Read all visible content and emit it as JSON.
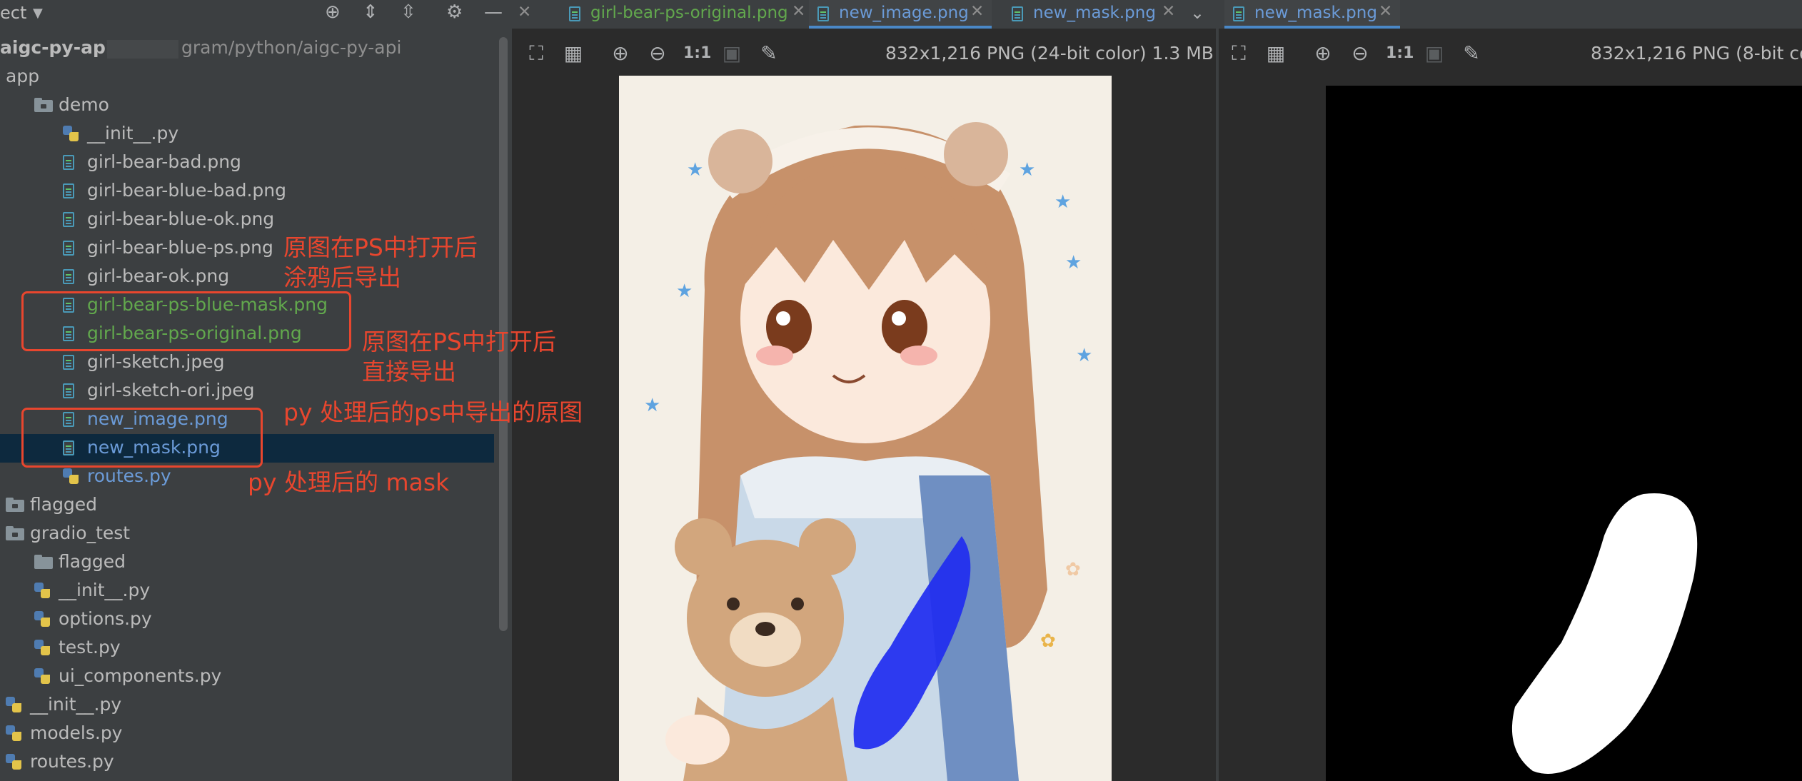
{
  "project_panel": {
    "header_label": "ect",
    "root_name": "aigc-py-api",
    "root_path": "gram/python/aigc-py-api",
    "items": [
      {
        "label": "app",
        "kind": "folder-open",
        "color": "white"
      },
      {
        "label": "demo",
        "kind": "folder",
        "color": "white"
      },
      {
        "label": "__init__.py",
        "kind": "py",
        "color": "white"
      },
      {
        "label": "girl-bear-bad.png",
        "kind": "img",
        "color": "white"
      },
      {
        "label": "girl-bear-blue-bad.png",
        "kind": "img",
        "color": "white"
      },
      {
        "label": "girl-bear-blue-ok.png",
        "kind": "img",
        "color": "white"
      },
      {
        "label": "girl-bear-blue-ps.png",
        "kind": "img",
        "color": "white"
      },
      {
        "label": "girl-bear-ok.png",
        "kind": "img",
        "color": "white"
      },
      {
        "label": "girl-bear-ps-blue-mask.png",
        "kind": "img",
        "color": "green"
      },
      {
        "label": "girl-bear-ps-original.png",
        "kind": "img",
        "color": "green"
      },
      {
        "label": "girl-sketch.jpeg",
        "kind": "img",
        "color": "white"
      },
      {
        "label": "girl-sketch-ori.jpeg",
        "kind": "img",
        "color": "white"
      },
      {
        "label": "new_image.png",
        "kind": "img",
        "color": "blue"
      },
      {
        "label": "new_mask.png",
        "kind": "img",
        "color": "blue",
        "selected": true
      },
      {
        "label": "routes.py",
        "kind": "py",
        "color": "blue"
      },
      {
        "label": "flagged",
        "kind": "folder",
        "color": "white"
      },
      {
        "label": "gradio_test",
        "kind": "folder",
        "color": "white"
      },
      {
        "label": "flagged",
        "kind": "folder-plain",
        "color": "white"
      },
      {
        "label": "__init__.py",
        "kind": "py",
        "color": "white"
      },
      {
        "label": "options.py",
        "kind": "py",
        "color": "white"
      },
      {
        "label": "test.py",
        "kind": "py",
        "color": "white"
      },
      {
        "label": "ui_components.py",
        "kind": "py",
        "color": "white"
      },
      {
        "label": "__init__.py",
        "kind": "py",
        "color": "white"
      },
      {
        "label": "models.py",
        "kind": "py",
        "color": "white"
      },
      {
        "label": "routes.py",
        "kind": "py",
        "color": "white"
      }
    ]
  },
  "annotations": {
    "note1_line1": "原图在PS中打开后",
    "note1_line2": "涂鸦后导出",
    "note2_line1": "原图在PS中打开后",
    "note2_line2": "直接导出",
    "note3": "py 处理后的ps中导出的原图",
    "note4": "py 处理后的 mask"
  },
  "tabs": [
    {
      "label": "girl-bear-ps-original.png",
      "active": false,
      "color": "green"
    },
    {
      "label": "new_image.png",
      "active": true,
      "color": "blue"
    },
    {
      "label": "new_mask.png",
      "active": false,
      "color": "blue"
    },
    {
      "label": "new_mask.png",
      "active": true,
      "color": "blue"
    }
  ],
  "viewer_left": {
    "info": "832x1,216 PNG (24-bit color) 1.3 MB",
    "zoom_actual_label": "1:1"
  },
  "viewer_right": {
    "info": "832x1,216 PNG (8-bit co",
    "zoom_actual_label": "1:1"
  },
  "colors": {
    "annotation": "#e8462e",
    "mask_blue": "#1f2cf0",
    "accent": "#4a88c7"
  }
}
